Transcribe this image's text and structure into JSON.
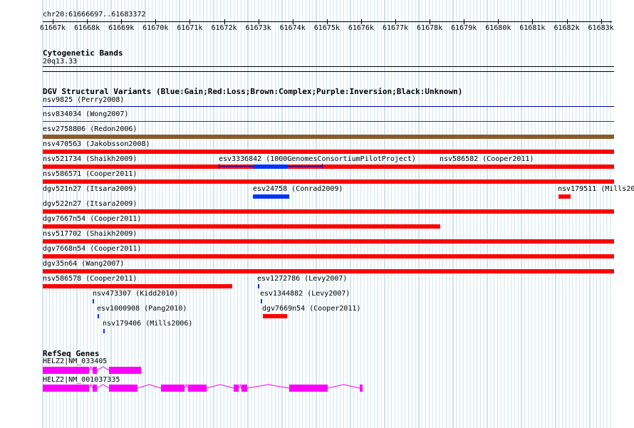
{
  "location": "chr20:61666697..61683372",
  "ruler_ticks": [
    "61667k",
    "61668k",
    "61669k",
    "61670k",
    "61671k",
    "61672k",
    "61673k",
    "61674k",
    "61675k",
    "61676k",
    "61677k",
    "61678k",
    "61679k",
    "61680k",
    "61681k",
    "61682k",
    "61683k"
  ],
  "cyto": {
    "title": "Cytogenetic Bands",
    "band": "20q13.33"
  },
  "dgv": {
    "title": "DGV Structural Variants (Blue:Gain;Red:Loss;Brown:Complex;Purple:Inversion;Black:Unknown)",
    "colors": {
      "gain": "#0033ff",
      "loss": "#ff0000",
      "complex": "#8b5a2b",
      "thin_gain": "#0000aa",
      "thin_loss": "#cc0000"
    },
    "items": [
      {
        "label": "nsv9825 (Perry2008)",
        "type": "thin_gain"
      },
      {
        "label": "nsv834034 (Wong2007)",
        "type": "thin_loss"
      },
      {
        "label": "esv2758806 (Redon2006)",
        "type": "complex"
      },
      {
        "label": "nsv470563 (Jakobsson2008)",
        "type": "loss"
      },
      {
        "label": "nsv521734 (Shaikh2009)",
        "type": "loss"
      },
      {
        "label": "esv3336842 (1000GenomesConsortiumPilotProject)",
        "type": "gain"
      },
      {
        "label": "nsv586582 (Cooper2011)",
        "type": "loss"
      },
      {
        "label": "nsv586571 (Cooper2011)",
        "type": "loss"
      },
      {
        "label": "dgv521n27 (Itsara2009)",
        "type": "loss"
      },
      {
        "label": "esv24758 (Conrad2009)",
        "type": "gain"
      },
      {
        "label": "nsv179511 (Mills2006)",
        "type": "loss"
      },
      {
        "label": "dgv522n27 (Itsara2009)",
        "type": "loss"
      },
      {
        "label": "dgv7667n54 (Cooper2011)",
        "type": "loss"
      },
      {
        "label": "nsv517702 (Shaikh2009)",
        "type": "loss"
      },
      {
        "label": "dgv7668n54 (Cooper2011)",
        "type": "loss"
      },
      {
        "label": "dgv35n64 (Wang2007)",
        "type": "loss"
      },
      {
        "label": "nsv586578 (Cooper2011)",
        "type": "loss"
      },
      {
        "label": "esv1272786 (Levy2007)",
        "type": "gain"
      },
      {
        "label": "nsv473307 (Kidd2010)",
        "type": "gain"
      },
      {
        "label": "esv1344882 (Levy2007)",
        "type": "gain"
      },
      {
        "label": "esv1000908 (Pang2010)",
        "type": "gain"
      },
      {
        "label": "dgv7669n54 (Cooper2011)",
        "type": "loss"
      },
      {
        "label": "nsv179406 (Mills2006)",
        "type": "gain"
      }
    ]
  },
  "refseq": {
    "title": "RefSeq Genes",
    "color": "#ff00ff",
    "genes": [
      {
        "label": "HELZ2|NM_033405"
      },
      {
        "label": "HELZ2|NM_001037335"
      }
    ]
  }
}
